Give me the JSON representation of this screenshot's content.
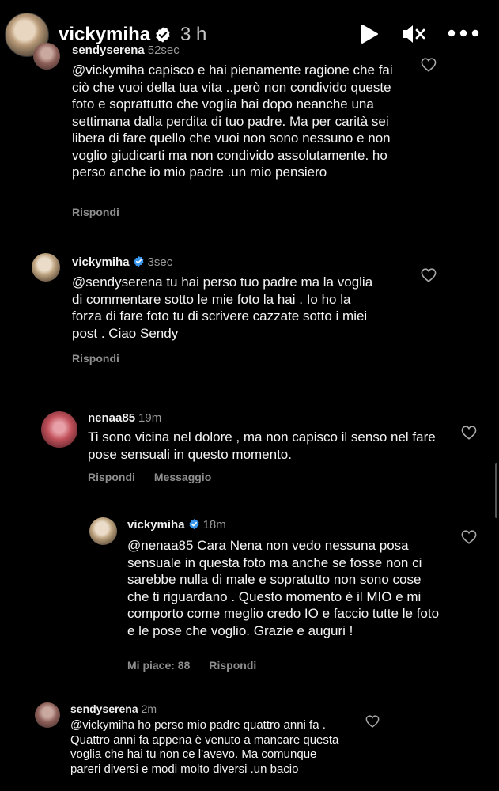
{
  "header": {
    "username": "vickymiha",
    "time": "3 h"
  },
  "comments": [
    {
      "username": "sendyserena",
      "time": "52sec",
      "text": "@vickymiha capisco e hai pienamente ragione che fai ciò che vuoi della tua vita ..però non condivido queste foto e soprattutto che voglia hai dopo neanche una settimana dalla perdita di tuo padre. Ma per carità sei libera di fare quello che vuoi non sono nessuno e non voglio giudicarti ma non condivido assolutamente. ho perso anche io mio padre .un mio pensiero",
      "reply_label": "Rispondi"
    },
    {
      "username": "vickymiha",
      "time": "3sec",
      "text": "@sendyserena tu hai perso tuo padre ma la voglia di commentare sotto le mie foto la hai . Io ho la forza di fare foto tu di scrivere cazzate sotto i miei post . Ciao Sendy",
      "reply_label": "Rispondi"
    },
    {
      "username": "nenaa85",
      "time": "19m",
      "text": "Ti sono vicina nel dolore , ma non capisco il senso nel fare pose sensuali in questo momento.",
      "reply_label": "Rispondi",
      "message_label": "Messaggio"
    },
    {
      "username": "vickymiha",
      "time": "18m",
      "text": "@nenaa85 Cara Nena non vedo nessuna posa sensuale in questa foto ma anche se fosse non ci sarebbe nulla di male e sopratutto non sono cose che ti riguardano . Questo momento è il MIO e mi comporto come meglio credo IO e faccio tutte le foto e le pose che voglio. Grazie e auguri !",
      "likes_label": "Mi piace: 88",
      "reply_label": "Rispondi"
    },
    {
      "username": "sendyserena",
      "time": "2m",
      "text": "@vickymiha ho perso mio padre quattro anni fa . Quattro anni fa appena è venuto a mancare questa voglia che hai tu non ce l'avevo. Ma comunque pareri diversi e modi molto diversi .un bacio"
    }
  ],
  "icons": {
    "verified_color": "#3897f0",
    "header_controls": [
      "play-icon",
      "mute-icon",
      "more-icon"
    ],
    "comment_like": "heart-icon"
  }
}
